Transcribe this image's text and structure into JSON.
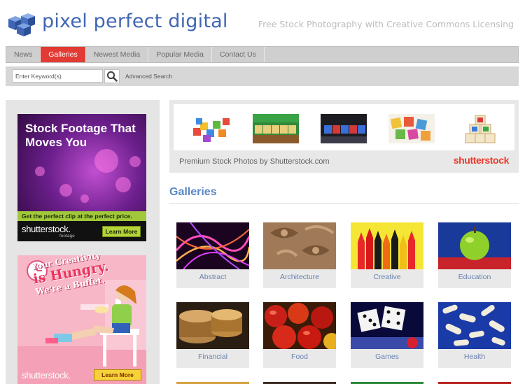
{
  "header": {
    "logo_text": "pixel perfect digital",
    "tagline": "Free Stock Photography with Creative Commons Licensing"
  },
  "nav": {
    "tabs": [
      {
        "label": "News",
        "active": false
      },
      {
        "label": "Galleries",
        "active": true
      },
      {
        "label": "Newest Media",
        "active": false
      },
      {
        "label": "Popular Media",
        "active": false
      },
      {
        "label": "Contact Us",
        "active": false
      }
    ]
  },
  "search": {
    "placeholder": "Enter Keyword(s)",
    "value": "",
    "advanced_label": "Advanced Search",
    "button_icon": "search-icon"
  },
  "sidebar": {
    "ad_footage": {
      "headline": "Stock Footage That Moves You",
      "strip": "Get the perfect clip at the perfect price.",
      "logo": "shutterstock.",
      "logo_sub": "footage",
      "button": "Learn More"
    },
    "ad_creative": {
      "line1": "Your Creativity",
      "line2": "is Hungry.",
      "line3": "We're a Buffet.",
      "logo": "shutterstock.",
      "button": "Learn More"
    }
  },
  "promo": {
    "caption": "Premium Stock Photos by Shutterstock.com",
    "logo": "shutterstock",
    "thumbs": [
      "letter-blocks-pile",
      "learn-blocks-green",
      "learn-blocks-dark",
      "abc-blocks-scattered",
      "abc-blocks-stack"
    ]
  },
  "galleries": {
    "title": "Galleries",
    "items": [
      {
        "label": "Abstract"
      },
      {
        "label": "Architecture"
      },
      {
        "label": "Creative"
      },
      {
        "label": "Education"
      },
      {
        "label": "Financial"
      },
      {
        "label": "Food"
      },
      {
        "label": "Games"
      },
      {
        "label": "Health"
      }
    ]
  },
  "colors": {
    "brand_blue": "#3f66b4",
    "active_tab": "#e23b33",
    "shutterstock_red": "#e83a2c",
    "gallery_label": "#6b83b0"
  }
}
